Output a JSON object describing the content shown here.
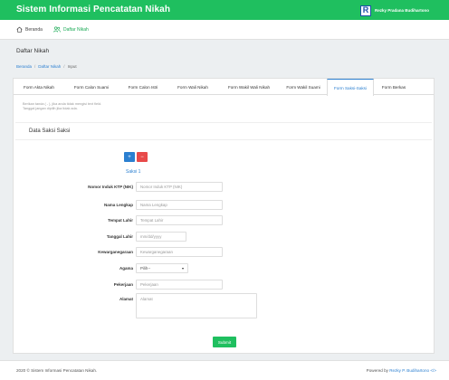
{
  "app": {
    "brand": "Sistem Informasi Pencatatan Nikah",
    "user_name": "Rezky Pradana Budihartono",
    "user_avatar_letter": "R"
  },
  "nav": {
    "home_label": "Beranda",
    "nikah_label": "Daftar Nikah"
  },
  "page": {
    "title": "Daftar Nikah",
    "breadcrumb": [
      "Beranda",
      "Daftar Nikah",
      "Input"
    ]
  },
  "tabs": [
    {
      "label": "Form Akta Nikah"
    },
    {
      "label": "Form Calon Suami"
    },
    {
      "label": "Form Calon Istri"
    },
    {
      "label": "Form Wali Nikah"
    },
    {
      "label": "Form Wakil Wali Nikah"
    },
    {
      "label": "Form Wakil Suami"
    },
    {
      "label": "Form Saksi-Saksi",
      "active": true
    },
    {
      "label": "Form Berkas"
    }
  ],
  "form": {
    "hint_line1": "Berikan tanda ( - ), jika anda tidak mengisi text field.",
    "hint_line2": "Tanggal jangan dipilih jika tidak ada.",
    "section_title": "Data Saksi Saksi",
    "add_symbol": "+",
    "remove_symbol": "−",
    "saksi_heading": "Saksi 1",
    "nik_label": "Nomor Induk KTP (NIK)",
    "nik_placeholder": "Nomor Induk KTP (NIK)",
    "nama_label": "Nama Lengkap",
    "nama_placeholder": "Nama Lengkap",
    "tempat_label": "Tempat Lahir",
    "tempat_placeholder": "Tempat Lahir",
    "tanggal_label": "Tanggal Lahir",
    "tanggal_placeholder": "mm/dd/yyyy",
    "warga_label": "Kewarganegaraan",
    "warga_placeholder": "Kewarganegaraan",
    "agama_label": "Agama",
    "agama_value": "Pilih--",
    "pekerjaan_label": "Pekerjaan",
    "pekerjaan_placeholder": "Pekerjaan",
    "alamat_label": "Alamat",
    "alamat_placeholder": "Alamat",
    "submit_label": "Submit"
  },
  "footer": {
    "copyright": "2020 © Sistem Informasi Pencatatan Nikah.",
    "powered_prefix": "Powered by",
    "author": "Rezky P. Budihartono",
    "author_suffix": "</>"
  },
  "colors": {
    "brand_green": "#1fbf5f",
    "link_blue": "#2b7fd0",
    "danger_red": "#e84a4a"
  }
}
